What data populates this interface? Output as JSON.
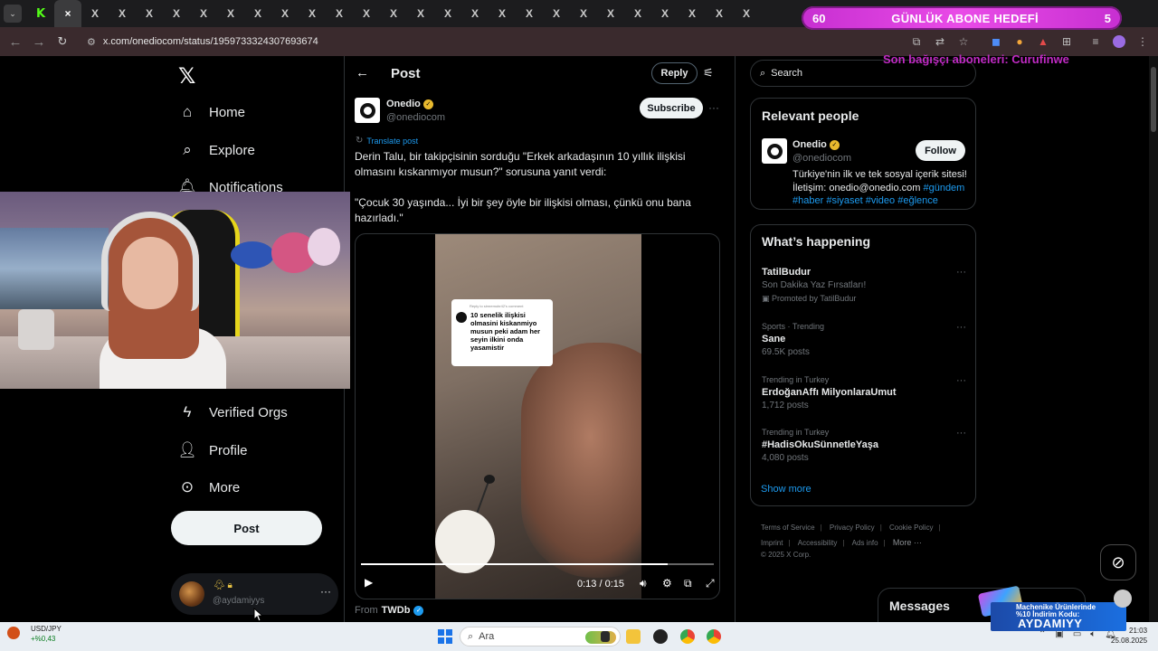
{
  "browser": {
    "tabs": [
      {
        "icon": "kick-icon",
        "glyph": "K"
      },
      {
        "icon": "x-icon",
        "glyph": "×",
        "active": true
      },
      {
        "icon": "x-icon",
        "glyph": "X"
      },
      {
        "icon": "x-icon",
        "glyph": "X"
      },
      {
        "icon": "x-icon",
        "glyph": "X"
      },
      {
        "icon": "x-icon",
        "glyph": "X"
      },
      {
        "icon": "x-icon",
        "glyph": "X"
      },
      {
        "icon": "x-icon",
        "glyph": "X"
      },
      {
        "icon": "x-icon",
        "glyph": "X"
      },
      {
        "icon": "x-icon",
        "glyph": "X"
      },
      {
        "icon": "x-icon",
        "glyph": "X"
      },
      {
        "icon": "x-icon",
        "glyph": "X"
      },
      {
        "icon": "x-icon",
        "glyph": "X"
      },
      {
        "icon": "x-icon",
        "glyph": "X"
      },
      {
        "icon": "x-icon",
        "glyph": "X"
      },
      {
        "icon": "x-icon",
        "glyph": "X"
      },
      {
        "icon": "x-icon",
        "glyph": "X"
      },
      {
        "icon": "x-icon",
        "glyph": "X"
      },
      {
        "icon": "x-icon",
        "glyph": "X"
      },
      {
        "icon": "x-icon",
        "glyph": "X"
      },
      {
        "icon": "x-icon",
        "glyph": "X"
      },
      {
        "icon": "x-icon",
        "glyph": "X"
      },
      {
        "icon": "x-icon",
        "glyph": "X"
      },
      {
        "icon": "x-icon",
        "glyph": "X"
      },
      {
        "icon": "x-icon",
        "glyph": "X"
      },
      {
        "icon": "x-icon",
        "glyph": "X"
      },
      {
        "icon": "x-icon",
        "glyph": "X"
      }
    ],
    "url": "x.com/onediocom/status/1959733324307693674"
  },
  "stream_overlay": {
    "goal_start": "60",
    "goal_title": "GÜNLÜK ABONE HEDEFİ",
    "goal_end": "5",
    "supporters": "Son bağışçı aboneleri: Curufinwe",
    "sponsor_line1": "Machenike Ürünlerinde",
    "sponsor_line2": "%10 İndirim Kodu:",
    "sponsor_code": "AYDAMIYY"
  },
  "nav": {
    "items": [
      {
        "label": "Home",
        "icon": "home-icon",
        "glyph": "⌂"
      },
      {
        "label": "Explore",
        "icon": "search-icon",
        "glyph": "⌕"
      },
      {
        "label": "Notifications",
        "icon": "bell-icon",
        "glyph": "🔔︎"
      },
      {
        "label": "Verified Orgs",
        "icon": "lightning-icon",
        "glyph": "ϟ"
      },
      {
        "label": "Profile",
        "icon": "person-icon",
        "glyph": "👤︎"
      },
      {
        "label": "More",
        "icon": "more-circle-icon",
        "glyph": "⊙"
      }
    ],
    "post_button": "Post",
    "account_handle": "@aydamiyys"
  },
  "post": {
    "header_title": "Post",
    "reply_button": "Reply",
    "author_name": "Onedio",
    "author_handle": "@onediocom",
    "subscribe_button": "Subscribe",
    "translate_label": "Translate post",
    "text_p1": "Derin Talu, bir takipçisinin sorduğu \"Erkek arkadaşının 10 yıllık ilişkisi olmasını kıskanmıyor musun?\" sorusuna yanıt verdi:",
    "text_p2": "\"Çocuk 30 yaşında... İyi bir şey öyle bir ilişkisi olması, çünkü onu bana hazırladı.\"",
    "video": {
      "caption_reply": "Reply to simremobr42's comment",
      "caption_text": "10 senelik ilişkisi olmasini kiskanmiyo musun peki adam her seyin ilkini onda yasamistir",
      "time": "0:13 / 0:15",
      "progress": 0.87
    },
    "from_label": "From",
    "from_source": "TWDb"
  },
  "sidebar": {
    "search_placeholder": "Search",
    "relevant_title": "Relevant people",
    "relevant": {
      "name": "Onedio",
      "handle": "@onediocom",
      "follow_button": "Follow",
      "bio_line1": "Türkiye'nin ilk ve tek sosyal içerik sitesi!",
      "bio_line2_prefix": "İletişim: onedio@onedio.com",
      "tags": [
        "#gündem",
        "#haber",
        "#siyaset",
        "#video",
        "#eğlence"
      ]
    },
    "happening_title": "What’s happening",
    "trends": [
      {
        "meta": "",
        "name": "TatilBudur",
        "sub": "Son Dakika Yaz Fırsatları!",
        "promo": "Promoted by TatilBudur"
      },
      {
        "meta": "Sports · Trending",
        "name": "Sane",
        "sub": "69.5K posts",
        "promo": ""
      },
      {
        "meta": "Trending in Turkey",
        "name": "ErdoğanAffı MilyonlaraUmut",
        "sub": "1,712 posts",
        "promo": ""
      },
      {
        "meta": "Trending in Turkey",
        "name": "#HadisOkuSünnetleYaşa",
        "sub": "4,080 posts",
        "promo": ""
      }
    ],
    "show_more": "Show more",
    "footer": {
      "links_row1": [
        "Terms of Service",
        "Privacy Policy",
        "Cookie Policy"
      ],
      "links_row2": [
        "Imprint",
        "Accessibility",
        "Ads info",
        "More ···"
      ],
      "copyright": "© 2025 X Corp."
    },
    "messages_label": "Messages"
  },
  "taskbar": {
    "ticker_pair": "USD/JPY",
    "ticker_change": "+%0,43",
    "search_label": "Ara",
    "time": "21:03",
    "date": "25.08.2025"
  }
}
